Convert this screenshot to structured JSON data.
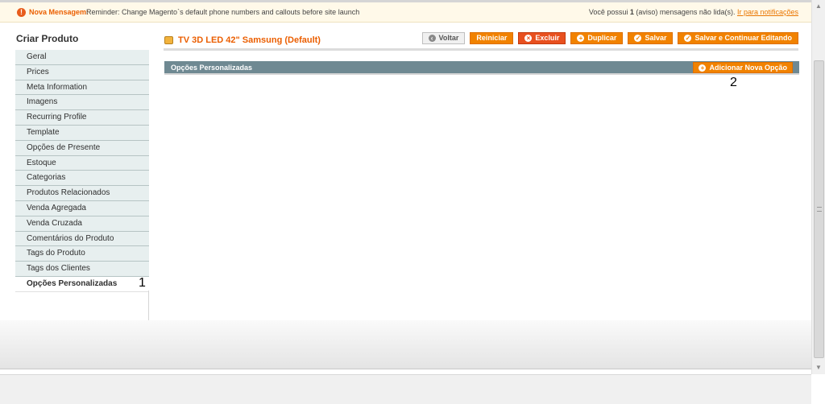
{
  "notice": {
    "title": "Nova Mensagem:",
    "message": "Reminder: Change Magento`s default phone numbers and callouts before site launch",
    "right_prefix": "Você possui ",
    "right_count": "1",
    "right_suffix": " (aviso) mensagens não lida(s). ",
    "link": "Ir para notificações"
  },
  "sidebar": {
    "title": "Criar Produto",
    "items": [
      {
        "label": "Geral"
      },
      {
        "label": "Prices"
      },
      {
        "label": "Meta Information"
      },
      {
        "label": "Imagens"
      },
      {
        "label": "Recurring Profile"
      },
      {
        "label": "Template"
      },
      {
        "label": "Opções de Presente"
      },
      {
        "label": "Estoque"
      },
      {
        "label": "Categorias"
      },
      {
        "label": "Produtos Relacionados"
      },
      {
        "label": "Venda Agregada"
      },
      {
        "label": "Venda Cruzada"
      },
      {
        "label": "Comentários do Produto"
      },
      {
        "label": "Tags do Produto"
      },
      {
        "label": "Tags dos Clientes"
      },
      {
        "label": "Opções Personalizadas"
      }
    ],
    "active_index": 15
  },
  "markers": {
    "one": "1",
    "two": "2"
  },
  "header": {
    "title": "TV 3D LED 42\" Samsung (Default)",
    "buttons": {
      "back": "Voltar",
      "reset": "Reiniciar",
      "delete": "Excluir",
      "duplicate": "Duplicar",
      "save": "Salvar",
      "save_continue": "Salvar e Continuar Editando"
    }
  },
  "section": {
    "title": "Opções Personalizadas",
    "add_button": "Adicionar Nova Opção"
  },
  "colors": {
    "accent": "#eb5e00",
    "button": "#f18200",
    "section_bar": "#6f8992",
    "sidebar_bg": "#e7efef"
  }
}
